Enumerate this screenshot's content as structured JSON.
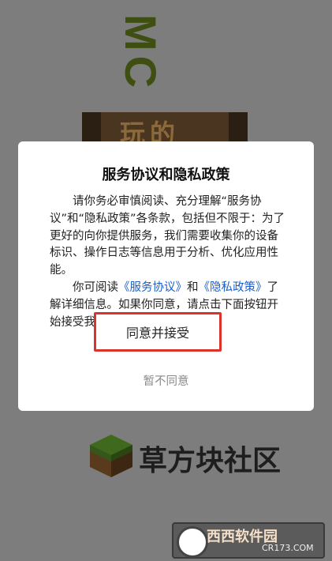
{
  "background": {
    "vertical_title": "MC",
    "logo_text": "玩的",
    "brand_name": "草方块社区"
  },
  "dialog": {
    "title": "服务协议和隐私政策",
    "paragraph1": "请你务必审慎阅读、充分理解“服务协议”和“隐私政策”各条款，包括但不限于：为了更好的向你提供服务，我们需要收集你的设备标识、操作日志等信息用于分析、优化应用性能。",
    "p2_before": "你可阅读",
    "service_link": "《服务协议》",
    "p2_and": "和",
    "privacy_link": "《隐私政策》",
    "p2_after": "了解详细信息。如果你同意，请点击下面按钮开始接受我们的服务。",
    "agree_label": "同意并接受",
    "decline_label": "暂不同意"
  },
  "watermark": {
    "name": "西西软件园",
    "domain": "CR173.COM"
  },
  "colors": {
    "overlay": "#7d7d7d",
    "link": "#1d5fc4",
    "highlight_border": "#d9332b",
    "decline_text": "#8a8a8a"
  }
}
